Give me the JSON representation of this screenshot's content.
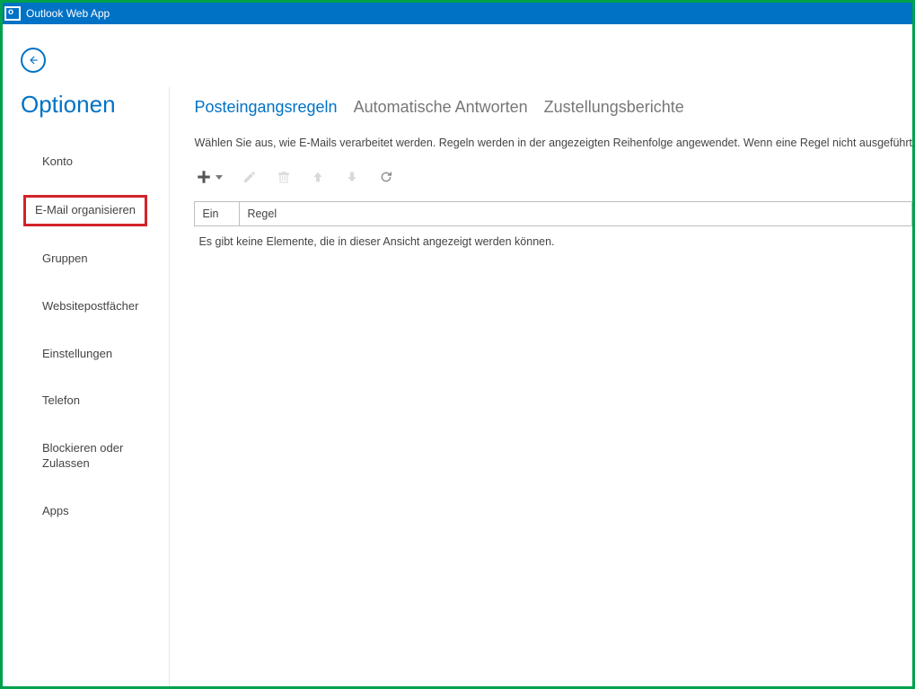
{
  "app": {
    "title": "Outlook Web App"
  },
  "sidebar": {
    "title": "Optionen",
    "items": [
      {
        "label": "Konto"
      },
      {
        "label": "E-Mail organisieren"
      },
      {
        "label": "Gruppen"
      },
      {
        "label": "Websitepostfächer"
      },
      {
        "label": "Einstellungen"
      },
      {
        "label": "Telefon"
      },
      {
        "label": "Blockieren oder Zulassen"
      },
      {
        "label": "Apps"
      }
    ]
  },
  "tabs": {
    "inbox_rules": "Posteingangsregeln",
    "auto_replies": "Automatische Antworten",
    "delivery_reports": "Zustellungsberichte"
  },
  "description": "Wählen Sie aus, wie E-Mails verarbeitet werden. Regeln werden in der angezeigten Reihenfolge angewendet. Wenn eine Regel nicht ausgeführt",
  "grid": {
    "columns": {
      "on": "Ein",
      "rule": "Regel"
    },
    "empty_text": "Es gibt keine Elemente, die in dieser Ansicht angezeigt werden können."
  }
}
